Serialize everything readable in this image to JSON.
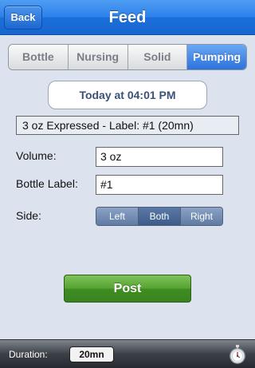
{
  "nav": {
    "title": "Feed",
    "back_label": "Back"
  },
  "tabs": [
    {
      "label": "Bottle",
      "active": false
    },
    {
      "label": "Nursing",
      "active": false
    },
    {
      "label": "Solid",
      "active": false
    },
    {
      "label": "Pumping",
      "active": true
    }
  ],
  "date_time": "Today at 04:01 PM",
  "summary": "3 oz Expressed - Label: #1 (20mn)",
  "form": {
    "volume_label": "Volume:",
    "volume_value": "3 oz",
    "bottle_label_label": "Bottle Label:",
    "bottle_label_value": "#1",
    "side_label": "Side:",
    "side_options": [
      "Left",
      "Both",
      "Right"
    ],
    "side_selected": "Both"
  },
  "post_label": "Post",
  "footer": {
    "duration_label": "Duration:",
    "duration_value": "20mn",
    "stopwatch_icon": "stopwatch-icon"
  },
  "colors": {
    "nav_blue": "#2c80ea",
    "active_tab": "#2b73dc",
    "post_green": "#55a331",
    "background": "#dde3ee"
  }
}
